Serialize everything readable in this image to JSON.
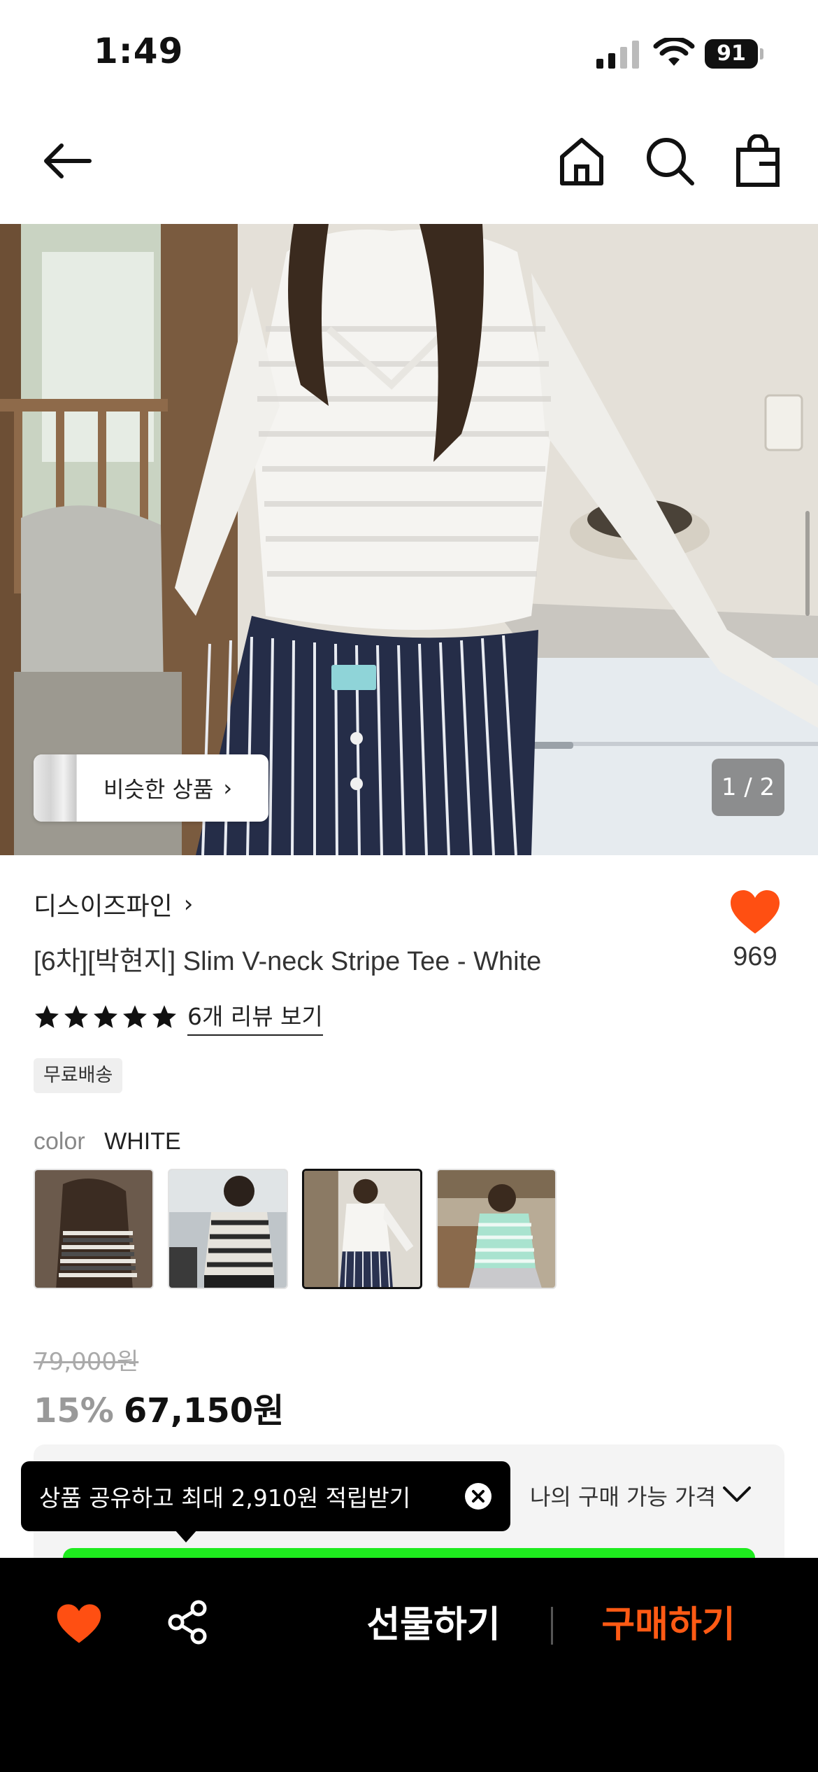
{
  "status": {
    "time": "1:49",
    "battery": "91"
  },
  "nav": {
    "icons": [
      "back-arrow-icon",
      "home-icon",
      "search-icon",
      "shopping-bag-icon"
    ]
  },
  "hero": {
    "similar_label": "비슷한 상품",
    "counter": "1 / 2"
  },
  "product": {
    "brand": "디스이즈파인",
    "title": "[6차][박현지] Slim V-neck Stripe Tee - White",
    "likes": "969",
    "rating_stars": 5,
    "review_link": "6개 리뷰 보기",
    "shipping_badge": "무료배송",
    "color_label": "color",
    "color_value": "WHITE",
    "selected_swatch_index": 2
  },
  "price": {
    "original": "79,000원",
    "discount": "15%",
    "sale": "67,150원",
    "my_price_label": "나의 구매 가능 가격"
  },
  "tooltip": {
    "text": "상품 공유하고 최대 2,910원 적립받기"
  },
  "bottom_bar": {
    "gift_label": "선물하기",
    "buy_label": "구매하기"
  },
  "colors": {
    "accent_orange": "#ff5a14",
    "heart_orange": "#ff4f12",
    "green_bar": "#1eeb1e"
  }
}
